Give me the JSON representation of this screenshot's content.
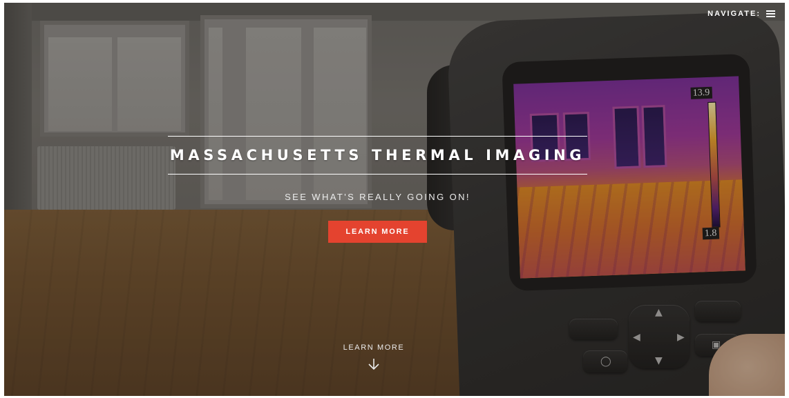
{
  "header": {
    "nav_label": "NAVIGATE:",
    "nav_icon": "hamburger-menu-icon"
  },
  "hero": {
    "title": "MASSACHUSETTS THERMAL IMAGING",
    "subtitle": "SEE WHAT'S REALLY GOING ON!",
    "cta_label": "LEARN MORE",
    "cta_color": "#e4432f",
    "scroll_label": "LEARN MORE",
    "scroll_icon": "arrow-down-icon"
  },
  "camera_display": {
    "scale_max": "13.9",
    "scale_min": "1.8"
  }
}
